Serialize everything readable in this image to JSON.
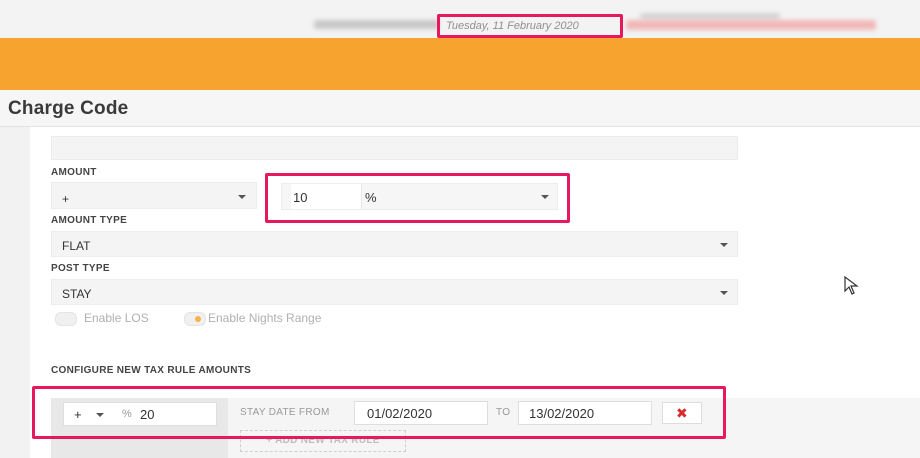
{
  "header": {
    "date": "Tuesday, 11 February 2020"
  },
  "page": {
    "title": "Charge Code"
  },
  "form": {
    "amount_label": "AMOUNT",
    "amount_sign": "+",
    "amount_value": "10",
    "amount_unit": "%",
    "amount_type_label": "AMOUNT TYPE",
    "amount_type_value": "FLAT",
    "post_type_label": "POST TYPE",
    "post_type_value": "STAY",
    "enable_los_label": "Enable LOS",
    "enable_nights_label": "Enable Nights Range"
  },
  "tax_rules": {
    "section_label": "CONFIGURE NEW TAX RULE AMOUNTS",
    "rule": {
      "sign": "+",
      "unit": "%",
      "value": "20",
      "stay_date_from_label": "STAY DATE FROM",
      "from_date": "01/02/2020",
      "to_label": "TO",
      "to_date": "13/02/2020"
    },
    "add_button_label": "+ ADD NEW TAX RULE"
  },
  "colors": {
    "accent_orange": "#f7a32f",
    "highlight": "#e7195c",
    "delete_red": "#d62c2c"
  },
  "icons": {
    "delete": "close-x-icon",
    "cursor": "mouse-pointer-icon"
  }
}
